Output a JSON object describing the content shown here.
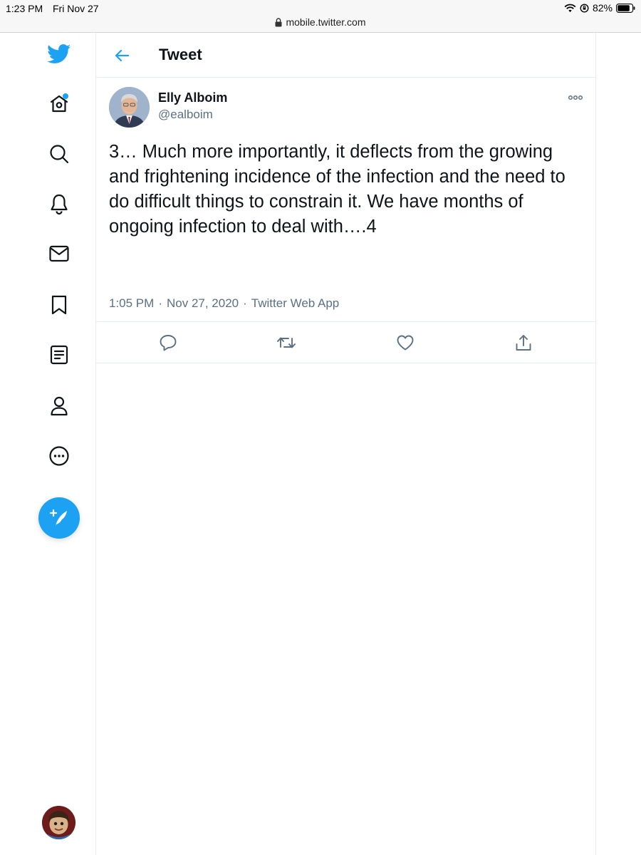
{
  "status_bar": {
    "time": "1:23 PM",
    "date": "Fri Nov 27",
    "battery": "82%"
  },
  "browser": {
    "url": "mobile.twitter.com"
  },
  "nav": {
    "items": [
      {
        "icon": "twitter-logo-icon"
      },
      {
        "icon": "home-icon"
      },
      {
        "icon": "search-icon"
      },
      {
        "icon": "bell-icon"
      },
      {
        "icon": "mail-icon"
      },
      {
        "icon": "bookmark-icon"
      },
      {
        "icon": "list-icon"
      },
      {
        "icon": "profile-icon"
      },
      {
        "icon": "more-circle-icon"
      }
    ],
    "compose_icon": "compose-tweet-icon"
  },
  "header": {
    "title": "Tweet"
  },
  "tweet": {
    "author_name": "Elly Alboim",
    "author_handle": "@ealboim",
    "text": "3… Much more importantly, it deflects from the growing and frightening incidence of the infection and the need to do difficult things to constrain it. We have months of ongoing infection to deal with….4",
    "time": "1:05 PM",
    "date": "Nov 27, 2020",
    "source": "Twitter Web App"
  },
  "colors": {
    "accent": "#1da1f2",
    "text": "#0f1419",
    "muted": "#5b7083",
    "border": "#e6ecf0"
  }
}
